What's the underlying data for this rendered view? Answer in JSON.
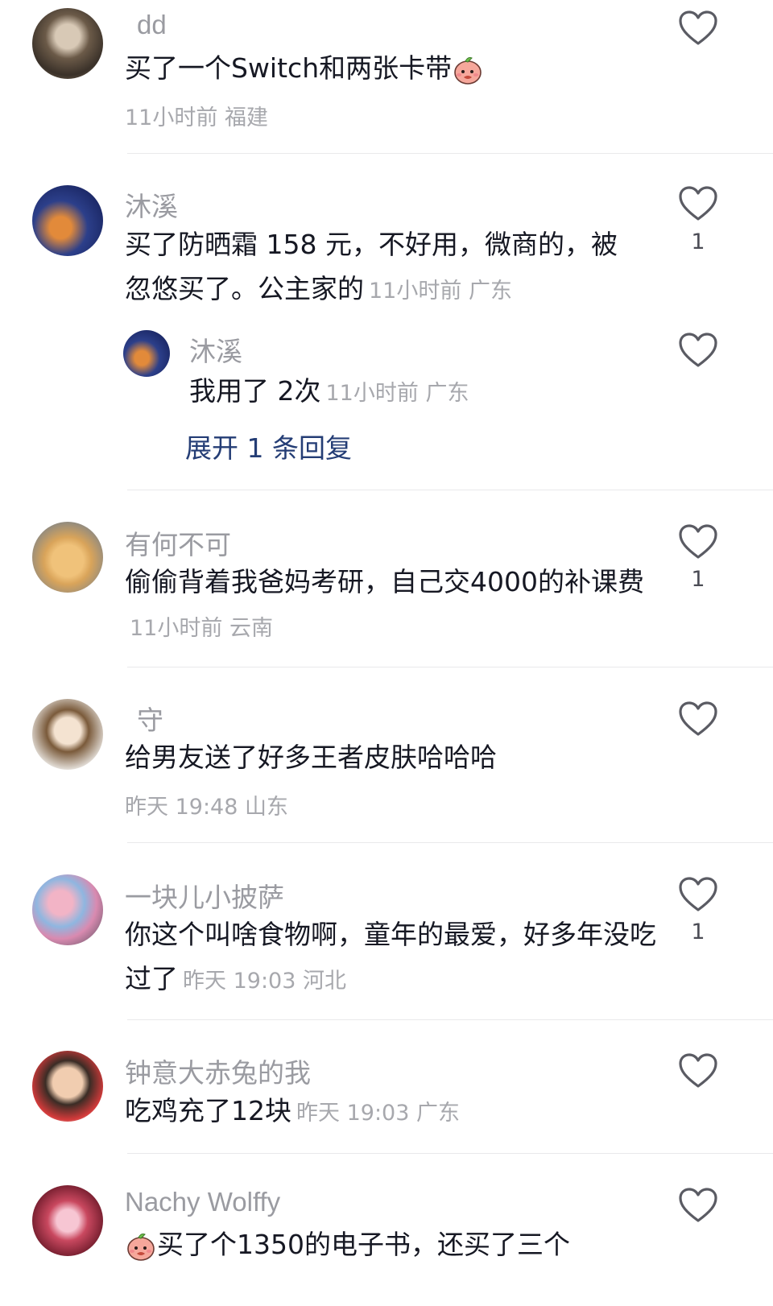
{
  "comments": [
    {
      "username": "dd",
      "text": "买了一个Switch和两张卡带",
      "meta": "11小时前 福建",
      "likes": ""
    },
    {
      "username": "沐溪",
      "text": "买了防晒霜 158 元，不好用，微商的，被忽悠买了。公主家的",
      "meta": "11小时前 广东",
      "likes": "1",
      "reply": {
        "username": "沐溪",
        "text": "我用了 2次",
        "meta": "11小时前 广东",
        "likes": ""
      },
      "expand_label": "展开 1 条回复"
    },
    {
      "username": "有何不可",
      "text": "偷偷背着我爸妈考研，自己交4000的补课费",
      "meta": "11小时前 云南",
      "likes": "1"
    },
    {
      "username": "守",
      "text": "给男友送了好多王者皮肤哈哈哈",
      "meta": "昨天 19:48 山东",
      "likes": ""
    },
    {
      "username": "一块儿小披萨",
      "text": "你这个叫啥食物啊，童年的最爱，好多年没吃过了",
      "meta": "昨天 19:03 河北",
      "likes": "1"
    },
    {
      "username": "钟意大赤兔的我",
      "text": "吃鸡充了12块",
      "meta": "昨天 19:03 广东",
      "likes": ""
    },
    {
      "username": "Nachy Wolffy",
      "text": "买了个1350的电子书，还买了三个",
      "meta": "",
      "likes": ""
    }
  ],
  "icons": {
    "like": "heart-outline-icon",
    "emoji": "peach-face-emoji-icon"
  },
  "colors": {
    "username": "#9a9ba1",
    "text": "#161823",
    "meta": "#a7a8ad",
    "expand": "#243d75"
  }
}
